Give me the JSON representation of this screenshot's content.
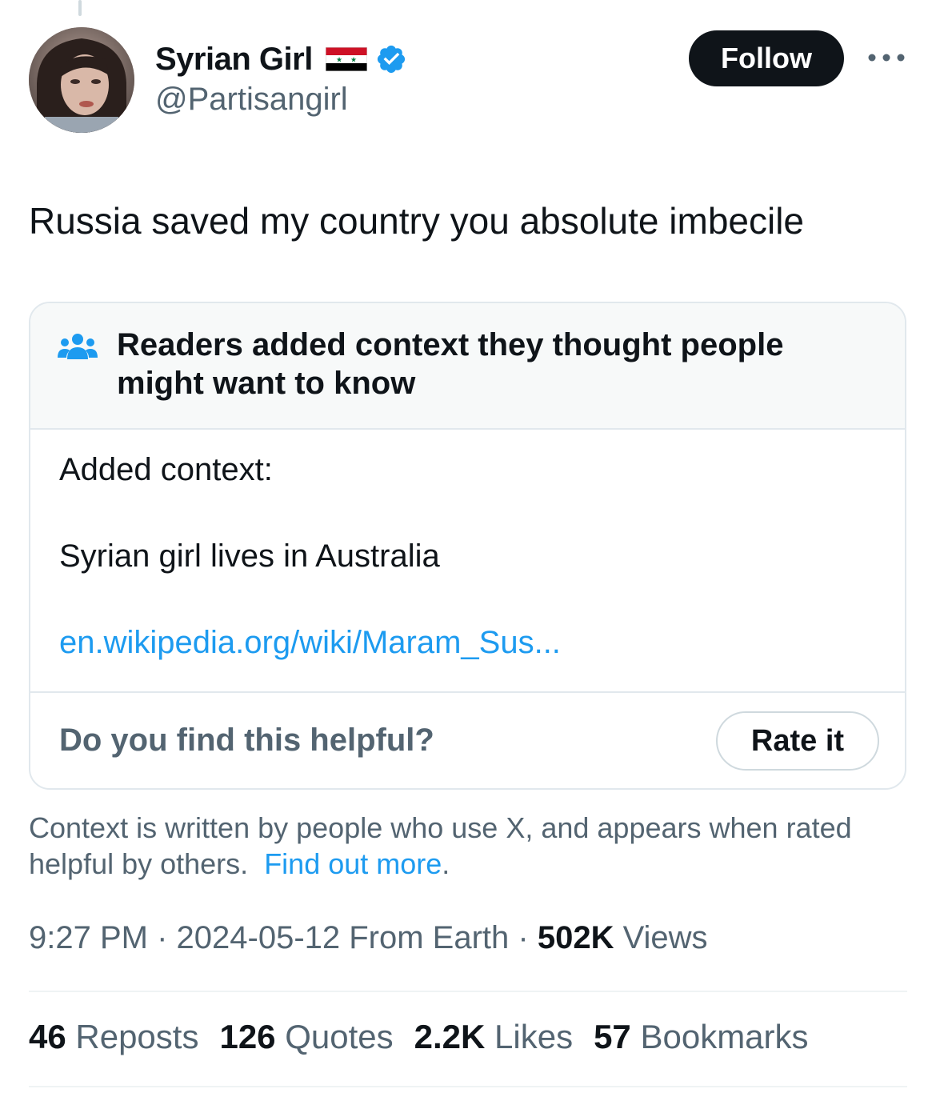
{
  "author": {
    "display_name": "Syrian Girl",
    "handle": "@Partisangirl",
    "flag_icon": "syria-flag",
    "verified_icon": "verified-badge-icon"
  },
  "follow_label": "Follow",
  "more_icon": "more-horizontal-icon",
  "tweet_text": "Russia saved my country you absolute imbecile",
  "community_note": {
    "icon": "people-group-icon",
    "title": "Readers added context they thought people might want to know",
    "added_label": "Added context:",
    "body": "Syrian girl lives in Australia",
    "link": "en.wikipedia.org/wiki/Maram_Sus...",
    "helpful_question": "Do you find this helpful?",
    "rate_label": "Rate it"
  },
  "context_info": {
    "text": "Context is written by people who use X, and appears when rated helpful by others.",
    "find_more": "Find out more",
    "trailing": "."
  },
  "meta": {
    "time": "9:27 PM",
    "sep1": " · ",
    "date": "2024-05-12 From Earth",
    "sep2": " · ",
    "views_count": "502K",
    "views_label": " Views"
  },
  "stats": [
    {
      "count": "46",
      "label": " Reposts"
    },
    {
      "count": "126",
      "label": " Quotes"
    },
    {
      "count": "2.2K",
      "label": " Likes"
    },
    {
      "count": "57",
      "label": " Bookmarks"
    }
  ],
  "colors": {
    "accent": "#1d9bf0",
    "text": "#0f1419",
    "secondary": "#536471"
  }
}
